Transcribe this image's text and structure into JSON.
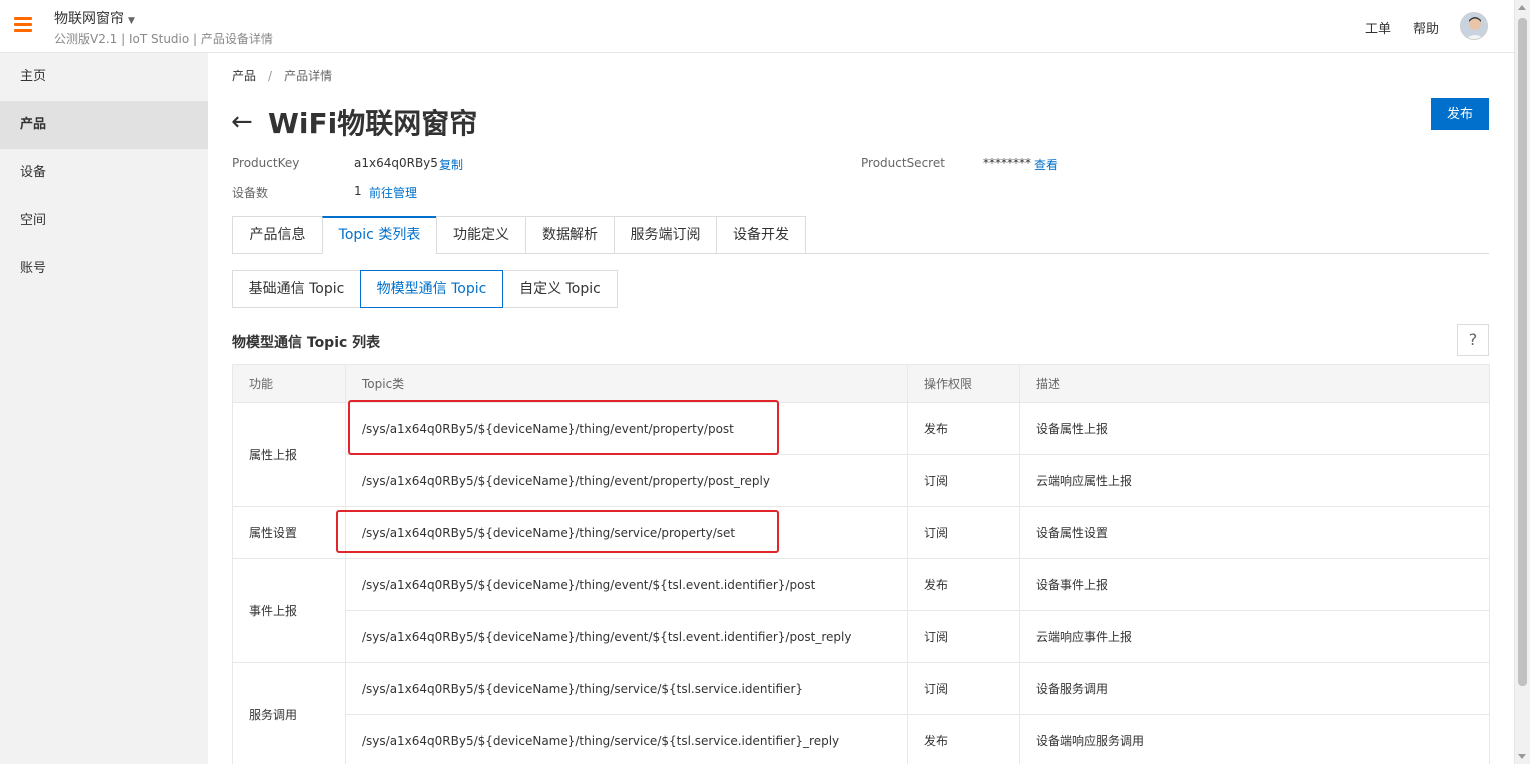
{
  "header": {
    "app_name": "物联网窗帘",
    "caret": "▼",
    "subtitle": "公测版V2.1 | IoT Studio | 产品设备详情",
    "ticket_label": "工单",
    "help_label": "帮助"
  },
  "sidebar": {
    "items": [
      {
        "label": "主页"
      },
      {
        "label": "产品"
      },
      {
        "label": "设备"
      },
      {
        "label": "空间"
      },
      {
        "label": "账号"
      }
    ],
    "active_index": 1
  },
  "breadcrumb": {
    "root": "产品",
    "sep": "/",
    "current": "产品详情"
  },
  "page": {
    "back_arrow": "←",
    "title": "WiFi物联网窗帘",
    "publish_label": "发布"
  },
  "meta": {
    "product_key_label": "ProductKey",
    "product_key_value": "a1x64q0RBy5",
    "copy_label": "复制",
    "device_count_label": "设备数",
    "device_count_value": "1",
    "manage_label": "前往管理",
    "product_secret_label": "ProductSecret",
    "product_secret_value": "********",
    "view_label": "查看"
  },
  "tabs": [
    {
      "label": "产品信息"
    },
    {
      "label": "Topic 类列表"
    },
    {
      "label": "功能定义"
    },
    {
      "label": "数据解析"
    },
    {
      "label": "服务端订阅"
    },
    {
      "label": "设备开发"
    }
  ],
  "active_tab": 1,
  "subtabs": [
    {
      "label": "基础通信 Topic"
    },
    {
      "label": "物模型通信 Topic"
    },
    {
      "label": "自定义 Topic"
    }
  ],
  "active_subtab": 1,
  "list": {
    "title": "物模型通信 Topic 列表",
    "help": "?"
  },
  "table": {
    "columns": [
      "功能",
      "Topic类",
      "操作权限",
      "描述"
    ],
    "groups": [
      {
        "function": "属性上报",
        "rows": [
          {
            "topic": "/sys/a1x64q0RBy5/${deviceName}/thing/event/property/post",
            "permission": "发布",
            "desc": "设备属性上报"
          },
          {
            "topic": "/sys/a1x64q0RBy5/${deviceName}/thing/event/property/post_reply",
            "permission": "订阅",
            "desc": "云端响应属性上报"
          }
        ]
      },
      {
        "function": "属性设置",
        "rows": [
          {
            "topic": "/sys/a1x64q0RBy5/${deviceName}/thing/service/property/set",
            "permission": "订阅",
            "desc": "设备属性设置"
          }
        ]
      },
      {
        "function": "事件上报",
        "rows": [
          {
            "topic": "/sys/a1x64q0RBy5/${deviceName}/thing/event/${tsl.event.identifier}/post",
            "permission": "发布",
            "desc": "设备事件上报"
          },
          {
            "topic": "/sys/a1x64q0RBy5/${deviceName}/thing/event/${tsl.event.identifier}/post_reply",
            "permission": "订阅",
            "desc": "云端响应事件上报"
          }
        ]
      },
      {
        "function": "服务调用",
        "rows": [
          {
            "topic": "/sys/a1x64q0RBy5/${deviceName}/thing/service/${tsl.service.identifier}",
            "permission": "订阅",
            "desc": "设备服务调用"
          },
          {
            "topic": "/sys/a1x64q0RBy5/${deviceName}/thing/service/${tsl.service.identifier}_reply",
            "permission": "发布",
            "desc": "设备端响应服务调用"
          }
        ]
      }
    ]
  },
  "colors": {
    "accent": "#0070cc",
    "brand_orange": "#ff6a00",
    "annotation_red": "#e0262b"
  }
}
